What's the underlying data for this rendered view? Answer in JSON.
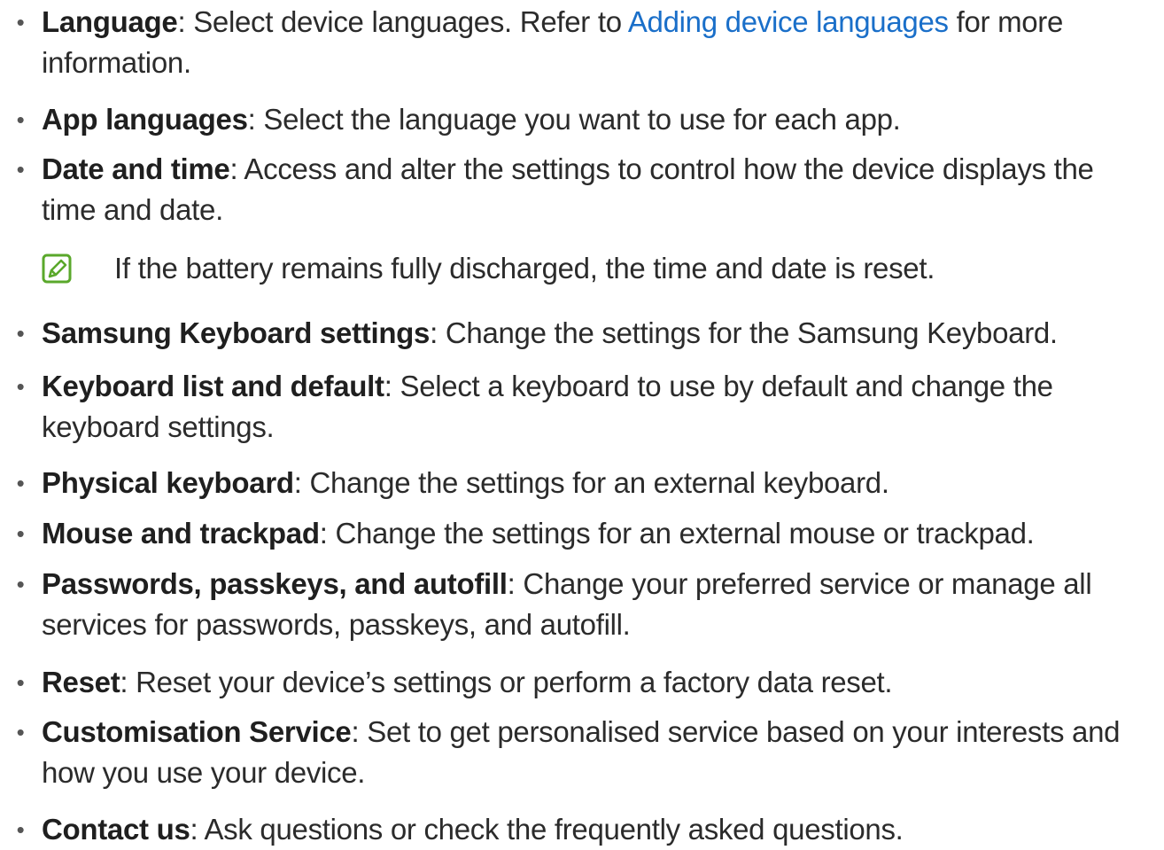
{
  "colors": {
    "text": "#2b2b2b",
    "link": "#1a6fc9",
    "note_icon": "#5aa82b"
  },
  "bullet_glyph": "•",
  "items": [
    {
      "term": "Language",
      "sep": ": ",
      "desc_before_link": "Select device languages. Refer to ",
      "link_text": "Adding device languages",
      "desc_after_link": " for more",
      "line2": "information."
    },
    {
      "term": "App languages",
      "sep": ": ",
      "desc": "Select the language you want to use for each app."
    },
    {
      "term": "Date and time",
      "sep": ": ",
      "desc": "Access and alter the settings to control how the device displays the",
      "line2": "time and date."
    },
    {
      "term": "Samsung Keyboard settings",
      "sep": ": ",
      "desc": "Change the settings for the Samsung Keyboard."
    },
    {
      "term": "Keyboard list and default",
      "sep": ": ",
      "desc": "Select a keyboard to use by default and change the",
      "line2": "keyboard settings."
    },
    {
      "term": "Physical keyboard",
      "sep": ": ",
      "desc": "Change the settings for an external keyboard."
    },
    {
      "term": "Mouse and trackpad",
      "sep": ": ",
      "desc": "Change the settings for an external mouse or trackpad."
    },
    {
      "term": "Passwords, passkeys, and autofill",
      "sep": ": ",
      "desc": "Change your preferred service or manage all",
      "line2": "services for passwords, passkeys, and autofill."
    },
    {
      "term": "Reset",
      "sep": ": ",
      "desc": "Reset your device’s settings or perform a factory data reset."
    },
    {
      "term": "Customisation Service",
      "sep": ": ",
      "desc": "Set to get personalised service based on your interests and",
      "line2": "how you use your device."
    },
    {
      "term": "Contact us",
      "sep": ": ",
      "desc": "Ask questions or check the frequently asked questions."
    }
  ],
  "note": {
    "icon": "note-pencil-icon",
    "text": "If the battery remains fully discharged, the time and date is reset."
  }
}
